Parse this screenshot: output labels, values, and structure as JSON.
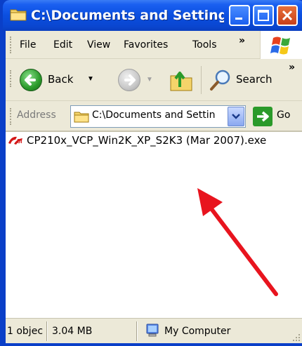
{
  "window": {
    "title": "C:\\Documents and Setting..."
  },
  "menu": {
    "items": [
      "File",
      "Edit",
      "View",
      "Favorites",
      "Tools"
    ],
    "more": "»"
  },
  "toolbar": {
    "back_label": "Back",
    "search_label": "Search",
    "more": "»"
  },
  "address": {
    "label": "Address",
    "value": "C:\\Documents and Settin",
    "go_label": "Go"
  },
  "files": [
    {
      "name": "CP210x_VCP_Win2K_XP_S2K3 (Mar 2007).exe",
      "icon": "silabs-icon"
    }
  ],
  "status": {
    "objects": "1 objec",
    "size": "3.04 MB",
    "location": "My Computer"
  },
  "colors": {
    "title_bar": "#0b4fe0",
    "chrome": "#ece9d8",
    "annotation_arrow": "#e8141e"
  }
}
